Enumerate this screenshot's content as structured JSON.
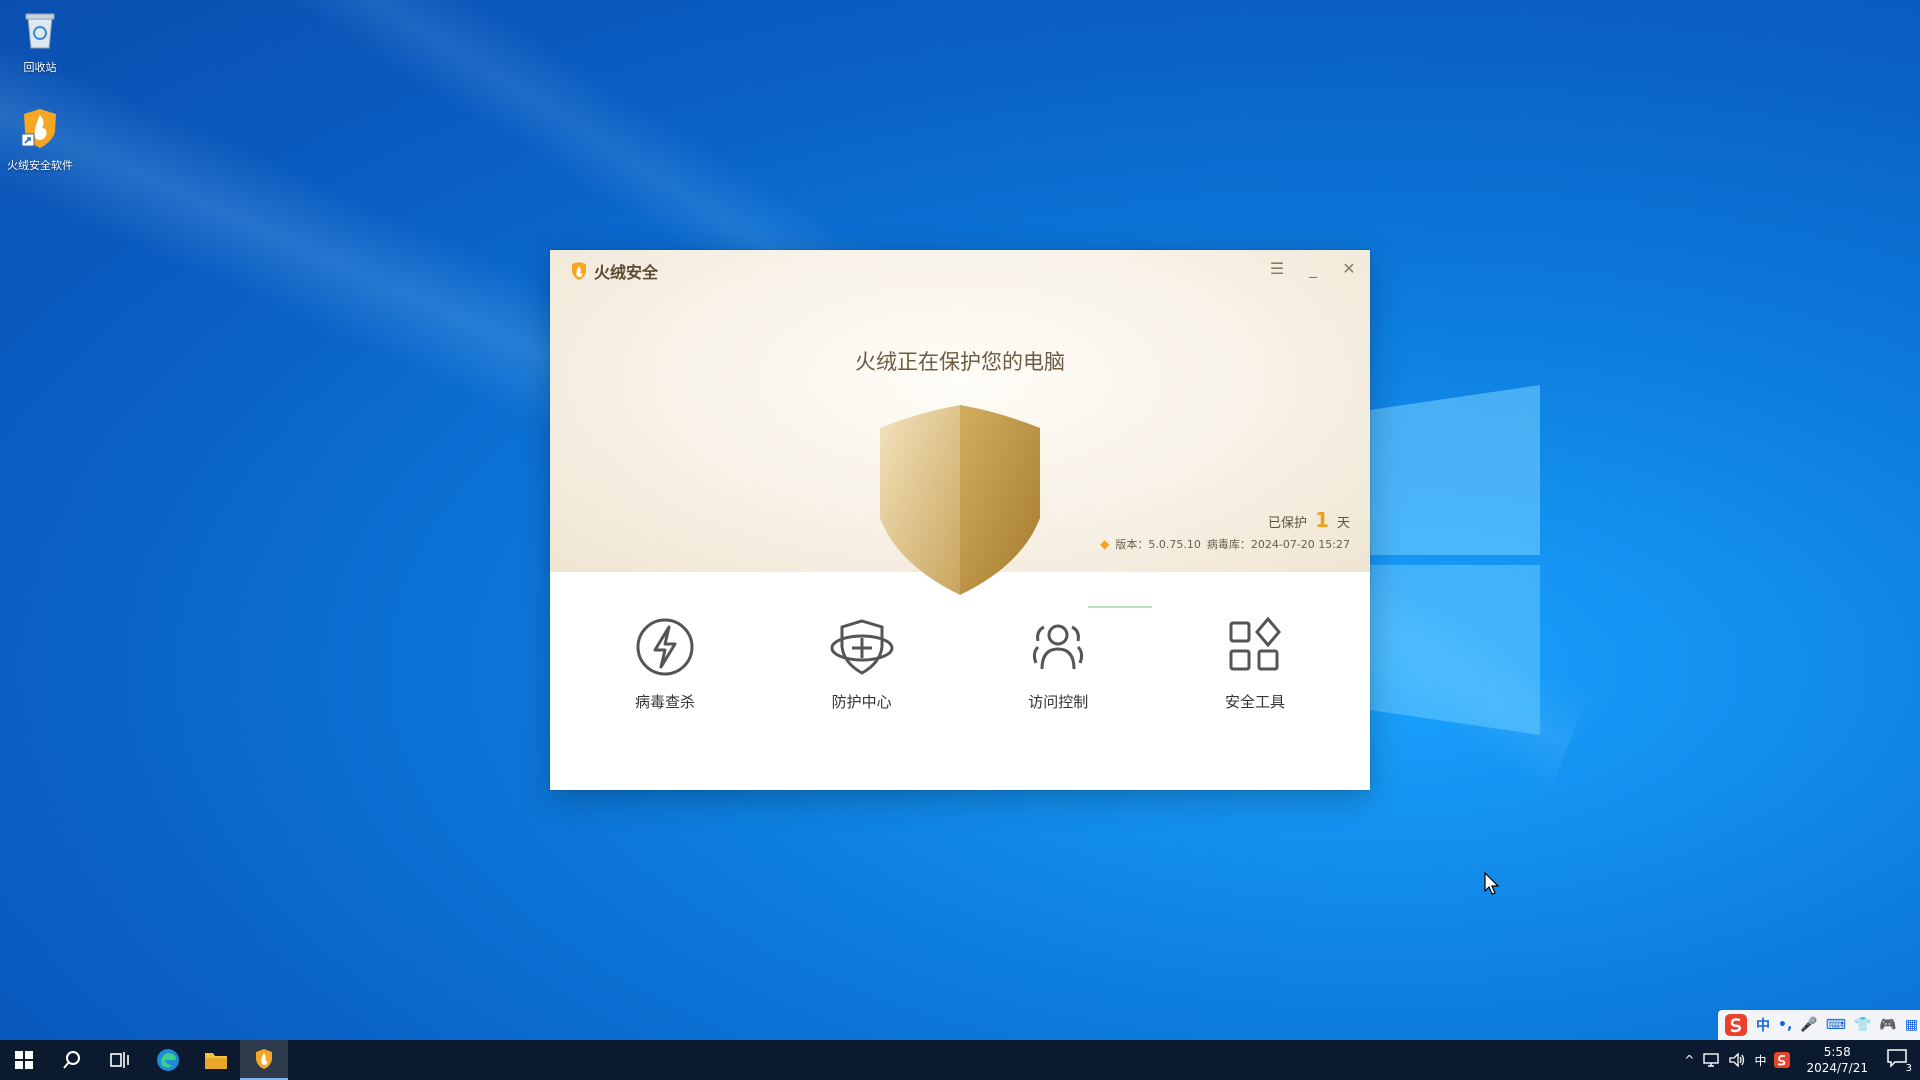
{
  "desktop": {
    "icons": [
      {
        "label": "回收站",
        "icon": "recycle-bin-icon"
      },
      {
        "label": "火绒安全软件",
        "icon": "huorong-shield-icon"
      }
    ]
  },
  "app": {
    "title": "火绒安全",
    "headline": "火绒正在保护您的电脑",
    "protected_prefix": "已保护",
    "protected_days": "1",
    "protected_suffix": "天",
    "version_label": "版本：5.0.75.10",
    "virus_db_label": "病毒库：2024-07-20 15:27",
    "features": [
      {
        "label": "病毒查杀",
        "icon": "lightning-icon"
      },
      {
        "label": "防护中心",
        "icon": "shield-plus-icon"
      },
      {
        "label": "访问控制",
        "icon": "users-icon"
      },
      {
        "label": "安全工具",
        "icon": "apps-grid-icon"
      }
    ],
    "accent": "#e8a21a"
  },
  "taskbar": {
    "apps": [
      "start-icon",
      "search-icon",
      "task-view-icon",
      "edge-icon",
      "file-explorer-icon",
      "huorong-icon"
    ],
    "tray": {
      "ime": "中",
      "time": "5:58",
      "date": "2024/7/21",
      "notifications": "3"
    },
    "ime_bar": [
      "中",
      "•,",
      "🎤",
      "⌨",
      "👕",
      "🎮",
      "▦"
    ]
  }
}
